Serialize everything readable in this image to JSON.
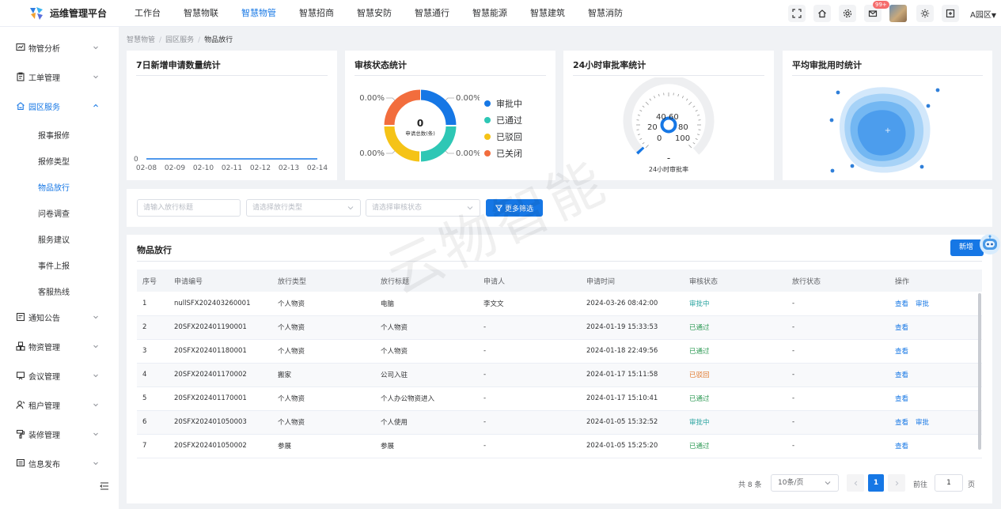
{
  "app": {
    "title": "运维管理平台"
  },
  "topnav": {
    "items": [
      {
        "label": "工作台"
      },
      {
        "label": "智慧物联"
      },
      {
        "label": "智慧物管"
      },
      {
        "label": "智慧招商"
      },
      {
        "label": "智慧安防"
      },
      {
        "label": "智慧通行"
      },
      {
        "label": "智慧能源"
      },
      {
        "label": "智慧建筑"
      },
      {
        "label": "智慧消防"
      }
    ],
    "active": "智慧物管",
    "message_badge": "99+",
    "area": "A园区"
  },
  "sidebar": {
    "items": [
      {
        "label": "物管分析",
        "icon": "analysis-icon"
      },
      {
        "label": "工单管理",
        "icon": "clipboard-icon"
      },
      {
        "label": "园区服务",
        "icon": "service-icon",
        "expanded": true,
        "children": [
          "报事报修",
          "报修类型",
          "物品放行",
          "问卷调查",
          "服务建议",
          "事件上报",
          "客服热线"
        ],
        "active_child": "物品放行"
      },
      {
        "label": "通知公告",
        "icon": "notice-icon"
      },
      {
        "label": "物资管理",
        "icon": "boxes-icon"
      },
      {
        "label": "会议管理",
        "icon": "meeting-icon"
      },
      {
        "label": "租户管理",
        "icon": "tenant-icon"
      },
      {
        "label": "装修管理",
        "icon": "decor-icon"
      },
      {
        "label": "信息发布",
        "icon": "publish-icon"
      }
    ]
  },
  "breadcrumb": [
    "智慧物管",
    "园区服务",
    "物品放行"
  ],
  "stats": {
    "new_requests": {
      "title": "7日新增申请数量统计",
      "chart_data": {
        "type": "line",
        "categories": [
          "02-08",
          "02-09",
          "02-10",
          "02-11",
          "02-12",
          "02-13",
          "02-14"
        ],
        "values": [
          0,
          0,
          0,
          0,
          0,
          0,
          0
        ],
        "ytick": "0"
      }
    },
    "status": {
      "title": "审核状态统计",
      "center_value": "0",
      "center_label": "申请总数(条)",
      "chart_data": {
        "type": "pie",
        "slices": [
          {
            "name": "审批中",
            "value": 25,
            "label": "0.00%",
            "color": "#1677e5"
          },
          {
            "name": "已通过",
            "value": 25,
            "label": "0.00%",
            "color": "#2ec7b5"
          },
          {
            "name": "已驳回",
            "value": 25,
            "label": "0.00%",
            "color": "#f5c317"
          },
          {
            "name": "已关闭",
            "value": 25,
            "label": "0.00%",
            "color": "#f26d3d"
          }
        ]
      }
    },
    "rate": {
      "title": "24小时审批率统计",
      "value": "-",
      "label": "24小时审批率",
      "ticks": [
        "0",
        "20",
        "40",
        "60",
        "80",
        "100"
      ]
    },
    "avg_time": {
      "title": "平均审批用时统计",
      "center_mark": "+"
    }
  },
  "filters": {
    "title_placeholder": "请输入放行标题",
    "type_placeholder": "请选择放行类型",
    "status_placeholder": "请选择审核状态",
    "more_label": "更多筛选"
  },
  "table": {
    "title": "物品放行",
    "add_label": "新增",
    "columns": [
      "序号",
      "申请编号",
      "放行类型",
      "放行标题",
      "申请人",
      "申请时间",
      "审核状态",
      "放行状态",
      "操作"
    ],
    "rows": [
      {
        "no": "1",
        "code": "nullSFX202403260001",
        "type": "个人物资",
        "title": "电脑",
        "applicant": "李文文",
        "time": "2024-03-26 08:42:00",
        "status": "审批中",
        "release": "-",
        "actions": [
          "查看",
          "审批"
        ]
      },
      {
        "no": "2",
        "code": "20SFX202401190001",
        "type": "个人物资",
        "title": "个人物资",
        "applicant": "-",
        "time": "2024-01-19 15:33:53",
        "status": "已通过",
        "release": "-",
        "actions": [
          "查看"
        ]
      },
      {
        "no": "3",
        "code": "20SFX202401180001",
        "type": "个人物资",
        "title": "个人物资",
        "applicant": "-",
        "time": "2024-01-18 22:49:56",
        "status": "已通过",
        "release": "-",
        "actions": [
          "查看"
        ]
      },
      {
        "no": "4",
        "code": "20SFX202401170002",
        "type": "搬家",
        "title": "公司入驻",
        "applicant": "-",
        "time": "2024-01-17 15:11:58",
        "status": "已驳回",
        "release": "-",
        "actions": [
          "查看"
        ]
      },
      {
        "no": "5",
        "code": "20SFX202401170001",
        "type": "个人物资",
        "title": "个人办公物资进入",
        "applicant": "-",
        "time": "2024-01-17 15:10:41",
        "status": "已通过",
        "release": "-",
        "actions": [
          "查看"
        ]
      },
      {
        "no": "6",
        "code": "20SFX202401050003",
        "type": "个人物资",
        "title": "个人使用",
        "applicant": "-",
        "time": "2024-01-05 15:32:52",
        "status": "审批中",
        "release": "-",
        "actions": [
          "查看",
          "审批"
        ]
      },
      {
        "no": "7",
        "code": "20SFX202401050002",
        "type": "参展",
        "title": "参展",
        "applicant": "-",
        "time": "2024-01-05 15:25:20",
        "status": "已通过",
        "release": "-",
        "actions": [
          "查看"
        ]
      }
    ]
  },
  "pagination": {
    "total": "共 8 条",
    "page_size": "10条/页",
    "current": "1",
    "goto_label": "前往",
    "goto_value": "1",
    "page_suffix": "页"
  },
  "watermark": "云物智能"
}
